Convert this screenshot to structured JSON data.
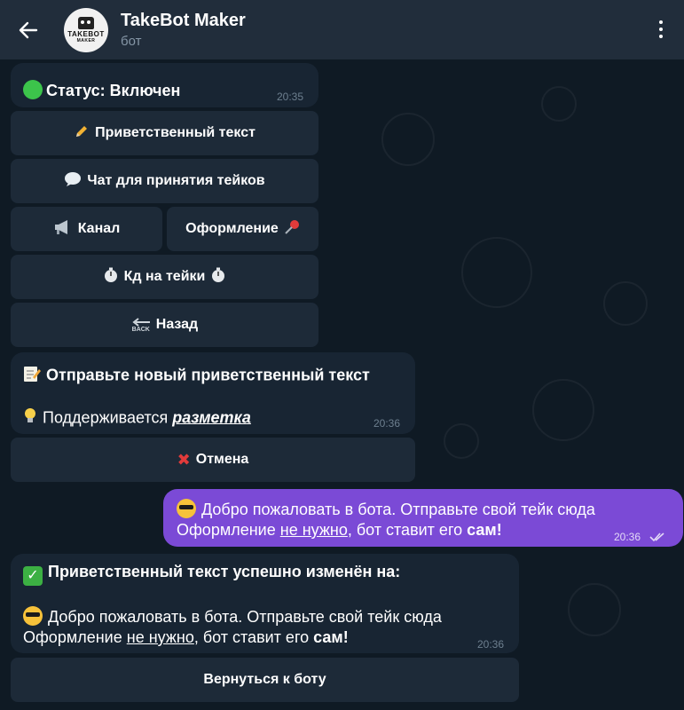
{
  "header": {
    "title": "TakeBot Maker",
    "subtitle": "бот",
    "avatar_text_1": "TAKEBOT",
    "avatar_text_2": "MAKER"
  },
  "messages": {
    "status": {
      "label": "Статус: Включен",
      "time": "20:35"
    },
    "status_keyboard": {
      "greeting": "Приветственный текст",
      "chat": "Чат для принятия тейков",
      "channel": "Канал",
      "design": "Оформление",
      "cooldown": "Кд на тейки",
      "back": "Назад",
      "back_icon_text": "BACK"
    },
    "prompt": {
      "line1": "Отправьте новый приветственный текст",
      "line2_prefix": "Поддерживается",
      "line2_link": "разметка",
      "time": "20:36"
    },
    "prompt_keyboard": {
      "cancel": "Отмена"
    },
    "user": {
      "line1": "Добро пожаловать в бота. Отправьте свой тейк сюда",
      "line2_a": "Оформление",
      "line2_b": "не нужно",
      "line2_c": ", бот ставит его",
      "line2_d": "сам!",
      "time": "20:36"
    },
    "confirm": {
      "line1": "Приветственный текст успешно изменён на:",
      "line2": "Добро пожаловать в бота. Отправьте свой тейк сюда",
      "line3_a": "Оформление",
      "line3_b": "не нужно",
      "line3_c": ", бот ставит его",
      "line3_d": "сам!",
      "time": "20:36"
    },
    "confirm_keyboard": {
      "back_to_bot": "Вернуться к боту"
    }
  },
  "colors": {
    "header_bg": "#212d3b",
    "incoming_bubble": "#182533",
    "outgoing_bubble": "#7b4ad6",
    "keyboard_button": "#1d2a38"
  }
}
